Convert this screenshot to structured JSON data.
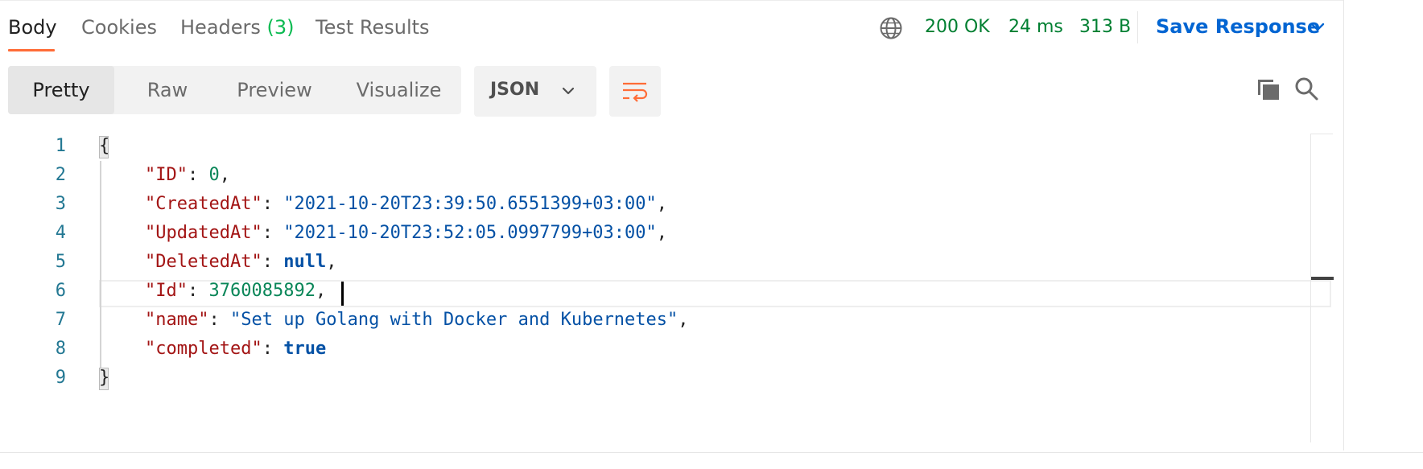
{
  "response_tabs": [
    {
      "label": "Body"
    },
    {
      "label": "Cookies"
    },
    {
      "label": "Headers",
      "count": "(3)"
    },
    {
      "label": "Test Results"
    }
  ],
  "status": {
    "code": "200 OK",
    "time": "24 ms",
    "size": "313 B"
  },
  "save_response": {
    "label": "Save Response"
  },
  "view_modes": [
    "Pretty",
    "Raw",
    "Preview",
    "Visualize"
  ],
  "format": {
    "selected": "JSON"
  },
  "icons": {
    "network": "globe-icon",
    "save_dropdown": "chevron-down-icon",
    "format_dropdown": "chevron-down-icon",
    "wrap": "wrap-lines-icon",
    "copy": "copy-icon",
    "search": "search-icon"
  },
  "code": {
    "line_numbers": [
      "1",
      "2",
      "3",
      "4",
      "5",
      "6",
      "7",
      "8",
      "9"
    ],
    "open_brace": "{",
    "close_brace": "}",
    "fields": [
      {
        "key": "\"ID\"",
        "sep": ": ",
        "value": "0",
        "kind": "num",
        "trail": ","
      },
      {
        "key": "\"CreatedAt\"",
        "sep": ": ",
        "value": "\"2021-10-20T23:39:50.6551399+03:00\"",
        "kind": "str",
        "trail": ","
      },
      {
        "key": "\"UpdatedAt\"",
        "sep": ": ",
        "value": "\"2021-10-20T23:52:05.0997799+03:00\"",
        "kind": "str",
        "trail": ","
      },
      {
        "key": "\"DeletedAt\"",
        "sep": ": ",
        "value": "null",
        "kind": "kw",
        "trail": ","
      },
      {
        "key": "\"Id\"",
        "sep": ": ",
        "value": "3760085892",
        "kind": "num",
        "trail": ","
      },
      {
        "key": "\"name\"",
        "sep": ": ",
        "value": "\"Set up Golang with Docker and Kubernetes\"",
        "kind": "str",
        "trail": ","
      },
      {
        "key": "\"completed\"",
        "sep": ": ",
        "value": "true",
        "kind": "kw",
        "trail": ""
      }
    ]
  },
  "colors": {
    "accent": "#ff6c37",
    "status_green": "#007f31",
    "link_blue": "#0265d2"
  }
}
